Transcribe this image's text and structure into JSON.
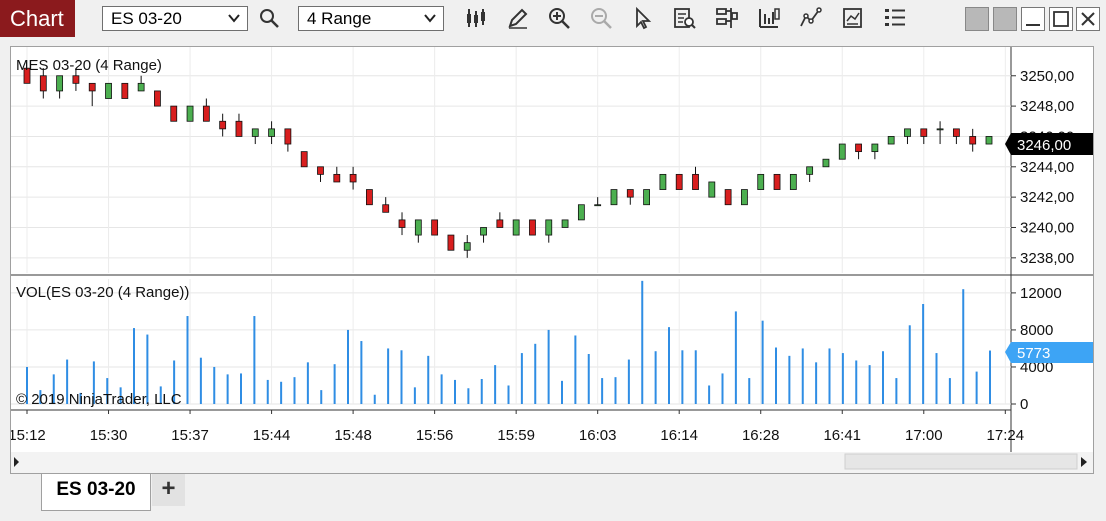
{
  "toolbar": {
    "title": "Chart",
    "instrument": "ES 03-20",
    "period": "4 Range",
    "icons": [
      "search-icon",
      "bar-type-icon",
      "draw-tool-icon",
      "zoom-in-icon",
      "zoom-out-icon",
      "pointer-icon",
      "data-box-icon",
      "properties-icon",
      "strategies-icon",
      "indicators-icon",
      "templates-icon",
      "order-entry-icon"
    ]
  },
  "price_panel": {
    "label": "MES 03-20 (4 Range)",
    "last_price": "3246,00"
  },
  "volume_panel": {
    "label": "VOL(ES 03-20 (4 Range))",
    "last_volume": "5773"
  },
  "copyright": "© 2019 NinjaTrader, LLC",
  "tabs": [
    {
      "label": "ES 03-20"
    }
  ],
  "add_tab_label": "+",
  "colors": {
    "title_bg": "#8b1a1d",
    "up": "#4caf50",
    "down": "#d81e1e",
    "volume": "#2f8de4",
    "last_price_bg": "#000000",
    "last_volume_bg": "#3da4f5"
  },
  "chart_data": [
    {
      "type": "candlestick",
      "title": "MES 03-20 (4 Range)",
      "ylim": [
        3237,
        3251.5
      ],
      "y_ticks": [
        "3250,00",
        "3248,00",
        "3246,00",
        "3244,00",
        "3242,00",
        "3240,00",
        "3238,00"
      ],
      "y_tick_values": [
        3250,
        3248,
        3246,
        3244,
        3242,
        3240,
        3238
      ],
      "x_ticks": [
        "15:12",
        "15:30",
        "15:37",
        "15:44",
        "15:48",
        "15:56",
        "15:59",
        "16:03",
        "16:14",
        "16:28",
        "16:41",
        "17:00",
        "17:24"
      ],
      "x_tick_bar_index": [
        0,
        5,
        10,
        15,
        20,
        25,
        30,
        35,
        40,
        45,
        50,
        55,
        60
      ],
      "bars_ohlc": [
        [
          3250.5,
          3250.5,
          3249.5,
          3249.5
        ],
        [
          3250.0,
          3250.5,
          3248.5,
          3249.0
        ],
        [
          3249.0,
          3250.0,
          3248.5,
          3250.0
        ],
        [
          3250.0,
          3250.5,
          3249.0,
          3249.5
        ],
        [
          3249.5,
          3249.5,
          3248.0,
          3249.0
        ],
        [
          3248.5,
          3249.5,
          3248.5,
          3249.5
        ],
        [
          3249.5,
          3249.5,
          3248.5,
          3248.5
        ],
        [
          3249.0,
          3250.0,
          3249.0,
          3249.5
        ],
        [
          3249.0,
          3249.0,
          3248.0,
          3248.0
        ],
        [
          3248.0,
          3248.0,
          3247.0,
          3247.0
        ],
        [
          3247.0,
          3248.0,
          3247.0,
          3248.0
        ],
        [
          3248.0,
          3248.5,
          3247.0,
          3247.0
        ],
        [
          3247.0,
          3247.5,
          3246.0,
          3246.5
        ],
        [
          3247.0,
          3247.5,
          3246.0,
          3246.0
        ],
        [
          3246.0,
          3246.5,
          3245.5,
          3246.5
        ],
        [
          3246.0,
          3247.0,
          3245.5,
          3246.5
        ],
        [
          3246.5,
          3246.5,
          3245.0,
          3245.5
        ],
        [
          3245.0,
          3245.0,
          3244.0,
          3244.0
        ],
        [
          3244.0,
          3244.0,
          3243.0,
          3243.5
        ],
        [
          3243.5,
          3244.0,
          3243.0,
          3243.0
        ],
        [
          3243.5,
          3244.0,
          3242.5,
          3243.0
        ],
        [
          3242.5,
          3242.5,
          3241.5,
          3241.5
        ],
        [
          3241.5,
          3242.0,
          3241.0,
          3241.0
        ],
        [
          3240.5,
          3241.0,
          3239.5,
          3240.0
        ],
        [
          3239.5,
          3240.5,
          3239.0,
          3240.5
        ],
        [
          3240.5,
          3240.5,
          3239.5,
          3239.5
        ],
        [
          3239.5,
          3239.5,
          3238.5,
          3238.5
        ],
        [
          3238.5,
          3239.5,
          3238.0,
          3239.0
        ],
        [
          3239.5,
          3240.0,
          3239.0,
          3240.0
        ],
        [
          3240.5,
          3241.0,
          3240.0,
          3240.0
        ],
        [
          3239.5,
          3240.5,
          3239.5,
          3240.5
        ],
        [
          3240.5,
          3240.5,
          3239.5,
          3239.5
        ],
        [
          3239.5,
          3240.5,
          3239.0,
          3240.5
        ],
        [
          3240.0,
          3240.5,
          3240.0,
          3240.5
        ],
        [
          3240.5,
          3241.5,
          3240.5,
          3241.5
        ],
        [
          3241.5,
          3242.0,
          3241.5,
          3241.5
        ],
        [
          3241.5,
          3242.5,
          3241.5,
          3242.5
        ],
        [
          3242.5,
          3242.5,
          3241.5,
          3242.0
        ],
        [
          3241.5,
          3242.5,
          3241.5,
          3242.5
        ],
        [
          3242.5,
          3243.5,
          3242.5,
          3243.5
        ],
        [
          3243.5,
          3243.5,
          3242.5,
          3242.5
        ],
        [
          3243.5,
          3244.0,
          3242.5,
          3242.5
        ],
        [
          3242.0,
          3243.0,
          3242.0,
          3243.0
        ],
        [
          3242.5,
          3242.5,
          3241.5,
          3241.5
        ],
        [
          3241.5,
          3242.5,
          3241.5,
          3242.5
        ],
        [
          3242.5,
          3243.5,
          3242.5,
          3243.5
        ],
        [
          3243.5,
          3243.5,
          3242.5,
          3242.5
        ],
        [
          3242.5,
          3243.5,
          3242.5,
          3243.5
        ],
        [
          3243.5,
          3244.0,
          3243.0,
          3244.0
        ],
        [
          3244.0,
          3244.5,
          3244.0,
          3244.5
        ],
        [
          3244.5,
          3245.5,
          3244.5,
          3245.5
        ],
        [
          3245.5,
          3245.5,
          3244.5,
          3245.0
        ],
        [
          3245.0,
          3245.5,
          3244.5,
          3245.5
        ],
        [
          3245.5,
          3246.0,
          3245.5,
          3246.0
        ],
        [
          3246.0,
          3246.5,
          3245.5,
          3246.5
        ],
        [
          3246.5,
          3246.5,
          3245.5,
          3246.0
        ],
        [
          3246.5,
          3247.0,
          3245.5,
          3246.5
        ],
        [
          3246.5,
          3246.5,
          3245.5,
          3246.0
        ],
        [
          3246.0,
          3246.5,
          3245.0,
          3245.5
        ],
        [
          3245.5,
          3246.0,
          3245.5,
          3246.0
        ]
      ]
    },
    {
      "type": "bar",
      "title": "VOL(ES 03-20 (4 Range))",
      "ylim": [
        0,
        13500
      ],
      "y_ticks": [
        "12000",
        "8000",
        "4000",
        "0"
      ],
      "y_tick_values": [
        12000,
        8000,
        4000,
        0
      ],
      "last_value": 5773,
      "values": [
        4000,
        1500,
        3200,
        4800,
        1200,
        4600,
        2800,
        1800,
        8200,
        7500,
        1900,
        4700,
        9500,
        5000,
        4000,
        3200,
        3300,
        9500,
        2600,
        2400,
        2900,
        4500,
        1500,
        4300,
        8000,
        6800,
        1000,
        6000,
        5800,
        1800,
        5200,
        3200,
        2600,
        1700,
        2700,
        4200,
        2000,
        5500,
        6500,
        8000,
        2500,
        7400,
        5400,
        2800,
        2900,
        4800,
        13300,
        5700,
        8300,
        5800,
        5800,
        2000,
        3300,
        10000,
        2800,
        9000,
        6100,
        5200,
        6000,
        4500,
        6000,
        5500,
        4700,
        4200,
        5700,
        2800,
        8500,
        10800,
        5500,
        2800,
        12400,
        3500,
        5773
      ]
    }
  ]
}
